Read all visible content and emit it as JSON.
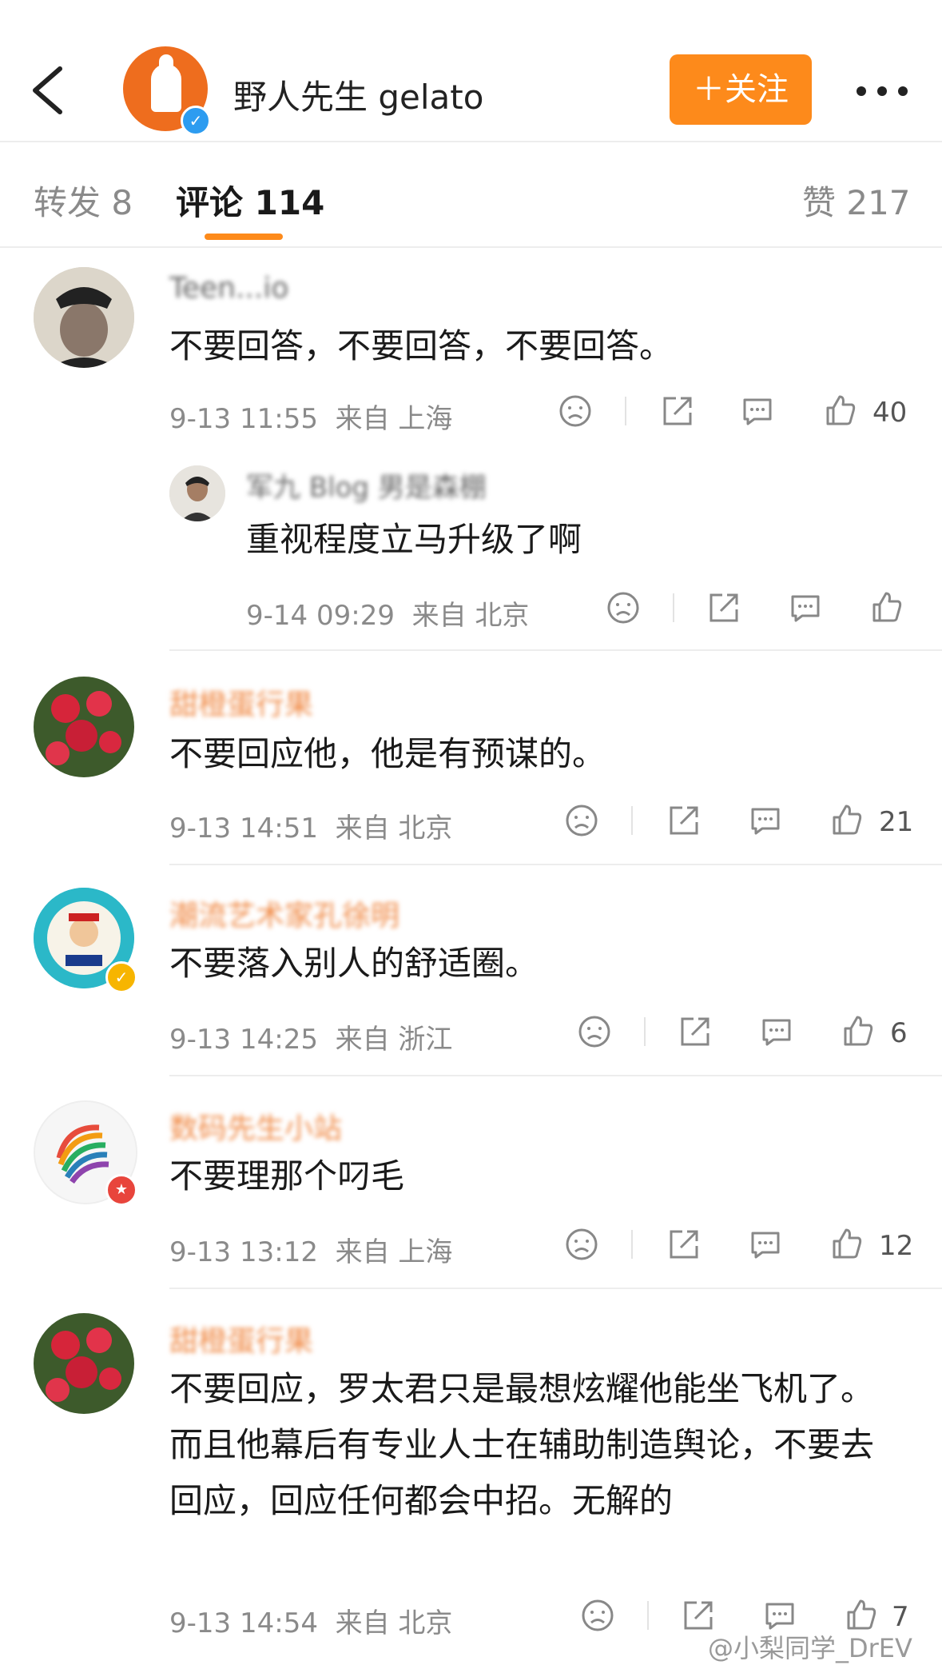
{
  "header": {
    "title": "野人先生 gelato",
    "follow_label": "＋关注"
  },
  "tabs": {
    "repost": "转发 8",
    "comments": "评论 114",
    "likes": "赞 217"
  },
  "comments": [
    {
      "username": "Teen...io",
      "text": "不要回答，不要回答，不要回答。",
      "time": "9-13 11:55",
      "location": "来自 上海",
      "likes": "40",
      "reply": {
        "username": "军九 Blog 男是森棚",
        "text": "重视程度立马升级了啊",
        "time": "9-14 09:29",
        "location": "来自 北京"
      }
    },
    {
      "username": "甜橙蛋行果",
      "text": "不要回应他，他是有预谋的。",
      "time": "9-13 14:51",
      "location": "来自 北京",
      "likes": "21"
    },
    {
      "username": "潮流艺术家孔徐明",
      "text": "不要落入别人的舒适圈。",
      "time": "9-13 14:25",
      "location": "来自 浙江",
      "likes": "6"
    },
    {
      "username": "数码先生小站",
      "text": "不要理那个叼毛",
      "time": "9-13 13:12",
      "location": "来自 上海",
      "likes": "12"
    },
    {
      "username": "甜橙蛋行果",
      "text": "不要回应，罗太君只是最想炫耀他能坐飞机了。而且他幕后有专业人士在辅助制造舆论，不要去回应，回应任何都会中招。无解的",
      "time": "9-13 14:54",
      "location": "来自 北京",
      "likes": "7"
    }
  ],
  "watermark": "@小梨同学_DrEV",
  "colors": {
    "accent": "#fd8a1b",
    "verified": "#2d9cf0",
    "username": "#f08a46"
  }
}
